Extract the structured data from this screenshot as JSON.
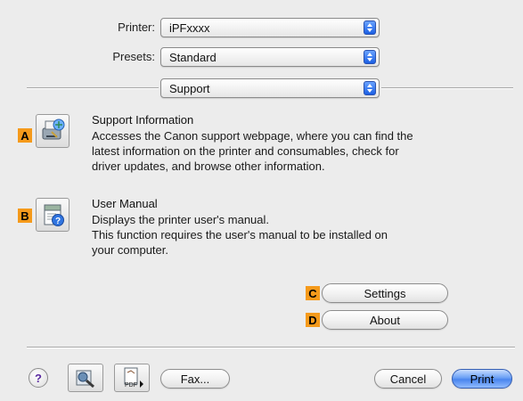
{
  "printer": {
    "label": "Printer:",
    "value": "iPFxxxx"
  },
  "presets": {
    "label": "Presets:",
    "value": "Standard"
  },
  "panel": {
    "value": "Support"
  },
  "support_info": {
    "marker": "A",
    "title": "Support Information",
    "lines": [
      "Accesses the Canon support webpage, where you can find the",
      "latest information on the printer and consumables, check for",
      "driver updates, and browse other information."
    ]
  },
  "user_manual": {
    "marker": "B",
    "title": "User Manual",
    "lines": [
      "Displays the printer user's manual.",
      "This function requires the user's manual to be installed on",
      "your computer."
    ]
  },
  "settings_button": {
    "marker": "C",
    "label": "Settings"
  },
  "about_button": {
    "marker": "D",
    "label": "About"
  },
  "footer": {
    "help": "?",
    "pdf_label": "PDF",
    "fax": "Fax...",
    "cancel": "Cancel",
    "print": "Print"
  },
  "colors": {
    "marker": "#f59a1b",
    "accent": "#4a86ee"
  },
  "icons": [
    "support-info-icon",
    "user-manual-icon",
    "help-icon",
    "preview-icon",
    "pdf-icon",
    "popup-arrows-icon"
  ]
}
